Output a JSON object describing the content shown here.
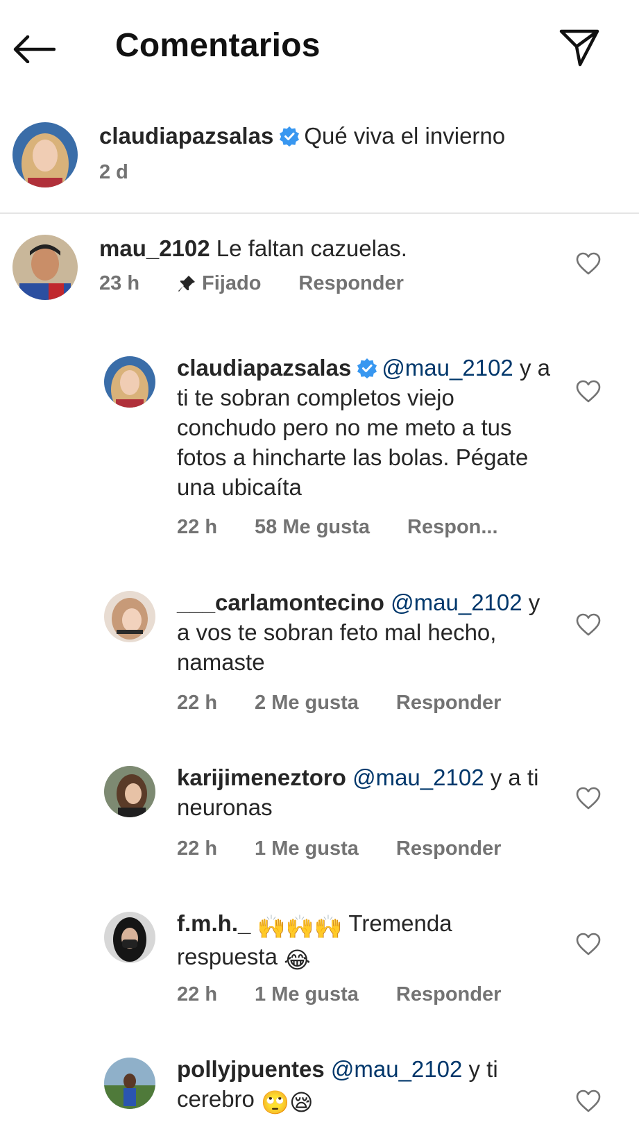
{
  "header": {
    "title": "Comentarios"
  },
  "caption": {
    "username": "claudiapazsalas",
    "text": "Qué viva el invierno",
    "time": "2 d"
  },
  "comments": [
    {
      "username": "mau_2102",
      "text": "Le faltan cazuelas.",
      "time": "23 h",
      "pinned_label": "Fijado",
      "reply_label": "Responder"
    },
    {
      "username": "claudiapazsalas",
      "mention": "@mau_2102",
      "text": "y a ti te sobran completos viejo conchudo pero no me meto a tus fotos a hincharte las bolas. Pégate una ubicaíta",
      "time": "22 h",
      "likes": "58 Me gusta",
      "reply_label": "Respon..."
    },
    {
      "username": "___carlamontecino",
      "mention": "@mau_2102",
      "text": "y a vos te sobran feto mal hecho, namaste",
      "time": "22 h",
      "likes": "2 Me gusta",
      "reply_label": "Responder"
    },
    {
      "username": "karijimeneztoro",
      "mention": "@mau_2102",
      "text": "y a ti neuronas",
      "time": "22 h",
      "likes": "1 Me gusta",
      "reply_label": "Responder"
    },
    {
      "username": "f.m.h._",
      "emoji_before": "🙌🙌🙌",
      "text": "Tremenda respuesta",
      "emoji_after": "😂",
      "time": "22 h",
      "likes": "1 Me gusta",
      "reply_label": "Responder"
    },
    {
      "username": "pollyjpuentes",
      "mention": "@mau_2102",
      "text": "y ti cerebro",
      "emoji_after": "🙄😪"
    }
  ],
  "colors": {
    "verified": "#3897f0",
    "mention": "#00376b",
    "meta": "#737373"
  },
  "icons": [
    "back-arrow-icon",
    "send-icon",
    "verified-badge-icon",
    "pin-icon",
    "heart-icon"
  ]
}
